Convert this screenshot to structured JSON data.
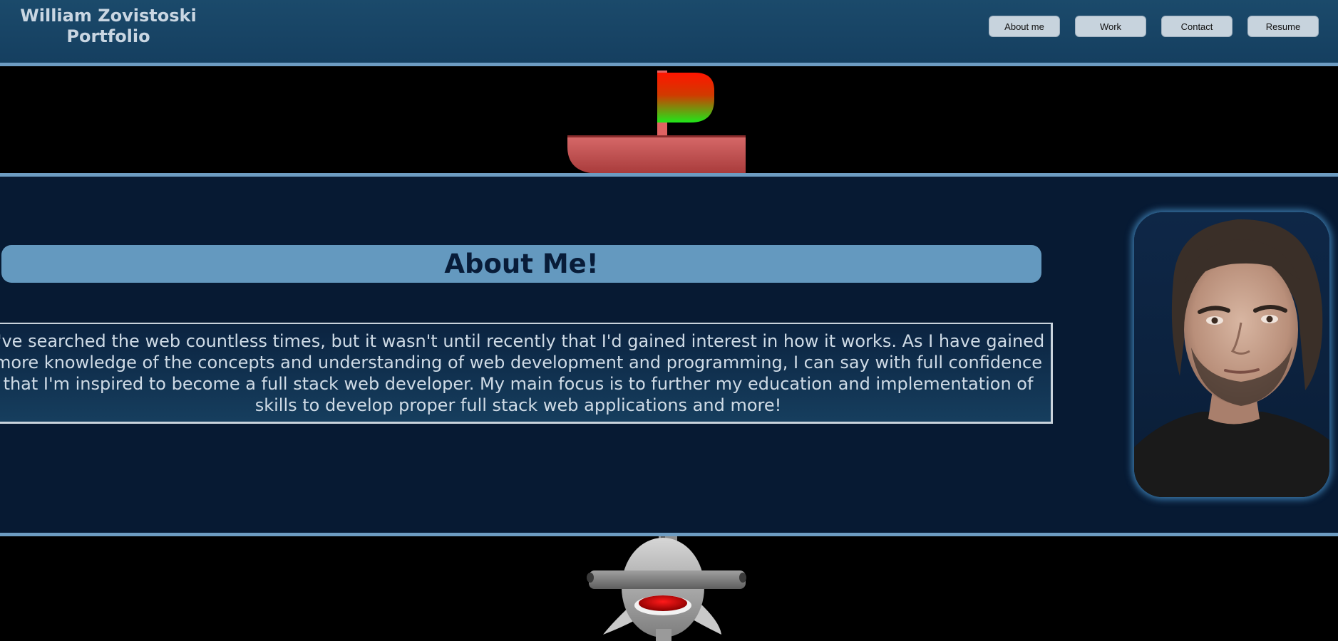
{
  "header": {
    "brand_line1": "William Zovistoski",
    "brand_line2": "Portfolio",
    "nav": [
      {
        "label": "About me"
      },
      {
        "label": "Work"
      },
      {
        "label": "Contact"
      },
      {
        "label": "Resume"
      }
    ]
  },
  "about": {
    "title": "About Me!",
    "body": "I've searched the web countless times, but it wasn't until recently that I'd gained interest in how it works. As I have gained more knowledge of the concepts and understanding of web development and programming, I can say with full confidence that I'm inspired to become a full stack web developer. My main focus is to further my education and implementation of skills to develop proper full stack web applications and more!"
  },
  "colors": {
    "header_bg": "#1b4a6b",
    "divider": "#6d9cc2",
    "title_bar": "#6499bf",
    "section_bg": "#071a33",
    "boat_hull": "#c95a5a",
    "flag_top": "#ff1a00",
    "flag_bottom": "#22e61a"
  },
  "icons": {
    "boat": "boat-icon",
    "submarine": "submarine-icon",
    "portrait": "portrait-photo"
  }
}
